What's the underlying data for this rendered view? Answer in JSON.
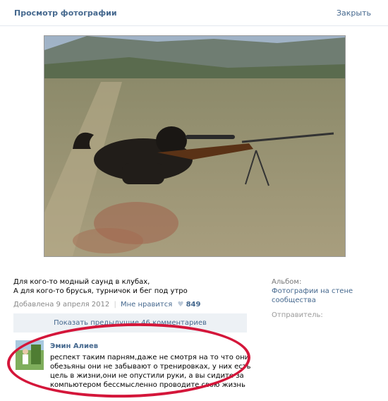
{
  "header": {
    "title": "Просмотр фотографии",
    "close_label": "Закрыть"
  },
  "photo": {
    "description_icon": "photo-image"
  },
  "caption": {
    "line1": "Для кого-то модный саунд в клубах,",
    "line2": "А для кого-то брусья, турничок и бег под утро"
  },
  "meta": {
    "added": "Добавлена 9 апреля 2012",
    "separator": "|",
    "like_label": "Мне нравится",
    "heart_icon": "heart-icon",
    "like_count": "849"
  },
  "sidebar": {
    "album_label": "Альбом:",
    "album_link": "Фотографии на стене сообщества",
    "sender_label": "Отправитель:"
  },
  "comments": {
    "show_all": "Показать предыдущие 46 комментариев",
    "items": [
      {
        "author": "Эмин Алиев",
        "text": "респект таким парням,даже не смотря на то что они обезьяны они не забывают о тренировках, у них есть цель в жизни,они не опустили руки, а вы сидите за компьютером бессмысленно проводите свою жизнь"
      }
    ]
  },
  "colors": {
    "link": "#45688e",
    "highlight": "#d4163a",
    "panel": "#edf1f5"
  }
}
